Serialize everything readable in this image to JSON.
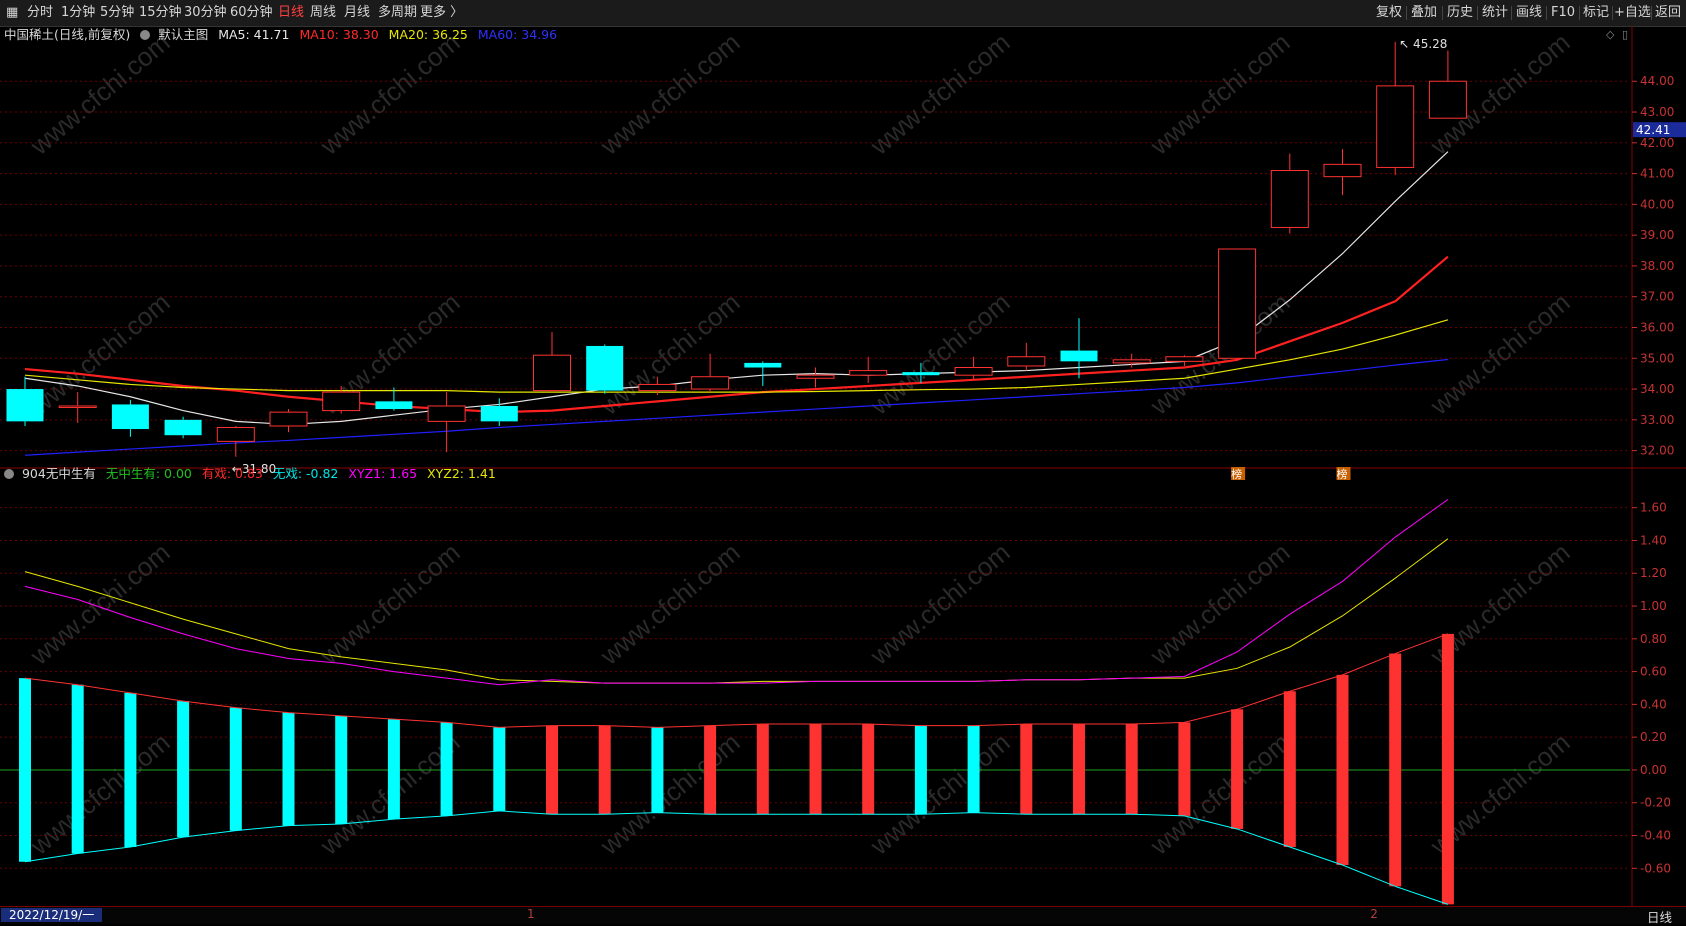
{
  "toolbar": {
    "left": [
      {
        "label": "分时",
        "name": "period-fenshi",
        "active": false
      },
      {
        "label": "1分钟",
        "name": "period-1min",
        "active": false
      },
      {
        "label": "5分钟",
        "name": "period-5min",
        "active": false
      },
      {
        "label": "15分钟",
        "name": "period-15min",
        "active": false
      },
      {
        "label": "30分钟",
        "name": "period-30min",
        "active": false
      },
      {
        "label": "60分钟",
        "name": "period-60min",
        "active": false
      },
      {
        "label": "日线",
        "name": "period-daily",
        "active": true
      },
      {
        "label": "周线",
        "name": "period-weekly",
        "active": false
      },
      {
        "label": "月线",
        "name": "period-monthly",
        "active": false
      },
      {
        "label": "多周期",
        "name": "period-multi",
        "active": false
      },
      {
        "label": "更多 〉",
        "name": "period-more",
        "active": false
      }
    ],
    "right": [
      {
        "label": "复权",
        "name": "fuquan-button"
      },
      {
        "label": "叠加",
        "name": "overlay-button"
      },
      {
        "label": "历史",
        "name": "history-button"
      },
      {
        "label": "统计",
        "name": "stats-button"
      },
      {
        "label": "画线",
        "name": "draw-line-button"
      },
      {
        "label": "F10",
        "name": "f10-button"
      },
      {
        "label": "标记",
        "name": "mark-button"
      },
      {
        "label": "+自选",
        "name": "add-watchlist-button"
      },
      {
        "label": "返回",
        "name": "back-button"
      }
    ]
  },
  "main_legend": {
    "title": "中国稀土(日线,前复权)",
    "template": "默认主图",
    "ma5": "MA5: 41.71",
    "ma10": "MA10: 38.30",
    "ma20": "MA20: 36.25",
    "ma60": "MA60: 34.96"
  },
  "sub_legend": {
    "title": "904无中生有",
    "v1": "无中生有: 0.00",
    "v2": "有戏: 0.83",
    "v3": "无戏: -0.82",
    "v4": "XYZ1: 1.65",
    "v5": "XYZ2: 1.41"
  },
  "colors": {
    "up": "#ff3232",
    "down": "#00ffff",
    "ma5": "#e6e6e6",
    "ma10": "#ff2020",
    "ma20": "#e6e600",
    "ma60": "#2020ff",
    "xyz1": "#ff00ff",
    "xyz2": "#e6e600",
    "grid": "#6b0000",
    "axis": "#c83232"
  },
  "chart_data": [
    {
      "type": "candlestick",
      "ylim": [
        31.5,
        45.6
      ],
      "y_ticks": [
        32,
        33,
        34,
        35,
        36,
        37,
        38,
        39,
        40,
        41,
        42,
        43,
        44
      ],
      "y_tick_labels": [
        "32.00",
        "33.00",
        "34.00",
        "35.00",
        "36.00",
        "37.00",
        "38.00",
        "39.00",
        "40.00",
        "41.00",
        "42.00",
        "43.00",
        "44.00"
      ],
      "current_price": "42.41",
      "annotations": {
        "high": "45.28",
        "low": "31.80"
      },
      "markers": [
        "榜",
        "榜"
      ],
      "marker_index": [
        23,
        25
      ],
      "candles": [
        {
          "o": 34.0,
          "h": 34.4,
          "l": 32.8,
          "c": 32.95
        },
        {
          "o": 33.45,
          "h": 33.9,
          "l": 32.9,
          "c": 33.45
        },
        {
          "o": 33.5,
          "h": 33.65,
          "l": 32.45,
          "c": 32.7
        },
        {
          "o": 33.0,
          "h": 33.1,
          "l": 32.4,
          "c": 32.5
        },
        {
          "o": 32.3,
          "h": 32.8,
          "l": 31.8,
          "c": 32.75
        },
        {
          "o": 32.8,
          "h": 33.35,
          "l": 32.6,
          "c": 33.25
        },
        {
          "o": 33.3,
          "h": 34.1,
          "l": 33.2,
          "c": 33.9
        },
        {
          "o": 33.6,
          "h": 34.05,
          "l": 33.3,
          "c": 33.35
        },
        {
          "o": 32.95,
          "h": 33.9,
          "l": 31.95,
          "c": 33.45
        },
        {
          "o": 33.45,
          "h": 33.7,
          "l": 32.8,
          "c": 32.95
        },
        {
          "o": 33.95,
          "h": 35.85,
          "l": 33.9,
          "c": 35.1
        },
        {
          "o": 35.4,
          "h": 35.45,
          "l": 33.85,
          "c": 33.95
        },
        {
          "o": 33.95,
          "h": 34.4,
          "l": 33.8,
          "c": 34.15
        },
        {
          "o": 34.0,
          "h": 35.15,
          "l": 33.9,
          "c": 34.4
        },
        {
          "o": 34.85,
          "h": 34.9,
          "l": 34.1,
          "c": 34.7
        },
        {
          "o": 34.35,
          "h": 34.7,
          "l": 34.05,
          "c": 34.45
        },
        {
          "o": 34.45,
          "h": 35.05,
          "l": 34.2,
          "c": 34.6
        },
        {
          "o": 34.55,
          "h": 34.85,
          "l": 34.2,
          "c": 34.45
        },
        {
          "o": 34.45,
          "h": 35.05,
          "l": 34.3,
          "c": 34.7
        },
        {
          "o": 34.75,
          "h": 35.5,
          "l": 34.6,
          "c": 35.05
        },
        {
          "o": 35.25,
          "h": 36.3,
          "l": 34.35,
          "c": 34.9
        },
        {
          "o": 34.85,
          "h": 35.15,
          "l": 34.7,
          "c": 34.95
        },
        {
          "o": 34.9,
          "h": 35.1,
          "l": 34.75,
          "c": 35.05
        },
        {
          "o": 35.0,
          "h": 38.55,
          "l": 35.0,
          "c": 38.55
        },
        {
          "o": 39.25,
          "h": 41.65,
          "l": 39.05,
          "c": 41.1
        },
        {
          "o": 40.9,
          "h": 41.8,
          "l": 40.3,
          "c": 41.3
        },
        {
          "o": 41.2,
          "h": 45.28,
          "l": 40.95,
          "c": 43.85
        },
        {
          "o": 42.8,
          "h": 45.0,
          "l": 42.8,
          "c": 44.0
        }
      ],
      "series": [
        {
          "name": "MA5",
          "values": [
            34.35,
            34.1,
            33.75,
            33.3,
            32.95,
            32.85,
            32.95,
            33.15,
            33.35,
            33.5,
            33.75,
            34.0,
            34.1,
            34.3,
            34.45,
            34.5,
            34.45,
            34.5,
            34.55,
            34.6,
            34.7,
            34.8,
            34.9,
            35.6,
            36.9,
            38.4,
            40.1,
            41.71
          ]
        },
        {
          "name": "MA10",
          "values": [
            34.65,
            34.5,
            34.3,
            34.1,
            33.95,
            33.75,
            33.6,
            33.45,
            33.35,
            33.25,
            33.3,
            33.45,
            33.6,
            33.75,
            33.9,
            34.0,
            34.1,
            34.2,
            34.3,
            34.4,
            34.5,
            34.6,
            34.7,
            34.95,
            35.55,
            36.15,
            36.85,
            38.3
          ]
        },
        {
          "name": "MA20",
          "values": [
            34.45,
            34.3,
            34.15,
            34.05,
            34.0,
            33.95,
            33.95,
            33.95,
            33.95,
            33.9,
            33.9,
            33.9,
            33.9,
            33.9,
            33.9,
            33.92,
            33.95,
            33.98,
            34.0,
            34.05,
            34.15,
            34.25,
            34.35,
            34.65,
            34.95,
            35.3,
            35.75,
            36.25
          ]
        },
        {
          "name": "MA60",
          "values": [
            31.85,
            31.95,
            32.05,
            32.15,
            32.25,
            32.33,
            32.43,
            32.53,
            32.63,
            32.75,
            32.85,
            32.95,
            33.05,
            33.15,
            33.25,
            33.35,
            33.45,
            33.55,
            33.65,
            33.75,
            33.85,
            33.95,
            34.05,
            34.2,
            34.4,
            34.58,
            34.78,
            34.96
          ]
        }
      ]
    },
    {
      "type": "bar",
      "ylim": [
        -0.83,
        1.72
      ],
      "y_ticks": [
        -0.6,
        -0.4,
        -0.2,
        0.0,
        0.2,
        0.4,
        0.6,
        0.8,
        1.0,
        1.2,
        1.4,
        1.6
      ],
      "y_tick_labels": [
        "-0.60",
        "-0.40",
        "-0.20",
        "0.00",
        "0.20",
        "0.40",
        "0.60",
        "0.80",
        "1.00",
        "1.20",
        "1.40",
        "1.60"
      ],
      "bar_index": [
        0,
        1,
        2,
        3,
        4,
        5,
        6,
        7,
        8,
        9,
        10,
        11,
        12,
        13,
        14,
        15,
        16,
        17,
        18,
        19,
        20,
        21,
        22,
        23,
        24,
        25,
        26,
        27
      ],
      "series": [
        {
          "name": "有戏",
          "values": [
            0.56,
            0.52,
            0.47,
            0.42,
            0.38,
            0.35,
            0.33,
            0.31,
            0.29,
            0.26,
            0.27,
            0.27,
            0.26,
            0.27,
            0.28,
            0.28,
            0.28,
            0.27,
            0.27,
            0.28,
            0.28,
            0.28,
            0.29,
            0.37,
            0.48,
            0.58,
            0.71,
            0.83
          ]
        },
        {
          "name": "无戏",
          "values": [
            -0.56,
            -0.51,
            -0.47,
            -0.41,
            -0.37,
            -0.34,
            -0.33,
            -0.3,
            -0.28,
            -0.25,
            -0.27,
            -0.27,
            -0.26,
            -0.27,
            -0.27,
            -0.27,
            -0.27,
            -0.27,
            -0.26,
            -0.27,
            -0.27,
            -0.27,
            -0.28,
            -0.36,
            -0.47,
            -0.58,
            -0.71,
            -0.82
          ]
        },
        {
          "name": "XYZ1",
          "values": [
            1.12,
            1.04,
            0.93,
            0.83,
            0.74,
            0.68,
            0.65,
            0.6,
            0.56,
            0.52,
            0.55,
            0.53,
            0.53,
            0.53,
            0.53,
            0.54,
            0.54,
            0.54,
            0.54,
            0.55,
            0.55,
            0.56,
            0.57,
            0.72,
            0.95,
            1.15,
            1.42,
            1.65
          ]
        },
        {
          "name": "XYZ2",
          "values": [
            1.21,
            1.12,
            1.02,
            0.92,
            0.83,
            0.74,
            0.69,
            0.65,
            0.61,
            0.55,
            0.54,
            0.53,
            0.53,
            0.53,
            0.54,
            0.54,
            0.54,
            0.54,
            0.54,
            0.55,
            0.55,
            0.56,
            0.56,
            0.62,
            0.75,
            0.94,
            1.17,
            1.41
          ]
        }
      ],
      "bar_colors": [
        "down",
        "down",
        "down",
        "down",
        "down",
        "down",
        "down",
        "down",
        "down",
        "down",
        "up",
        "up",
        "down",
        "up",
        "up",
        "up",
        "up",
        "down",
        "down",
        "up",
        "up",
        "up",
        "up",
        "up",
        "up",
        "up",
        "up",
        "up"
      ]
    }
  ],
  "x_axis": {
    "date_label": "2022/12/19/一",
    "month_marks": [
      {
        "label": "1",
        "index": 10
      },
      {
        "label": "2",
        "index": 26
      }
    ],
    "period_label": "日线"
  }
}
